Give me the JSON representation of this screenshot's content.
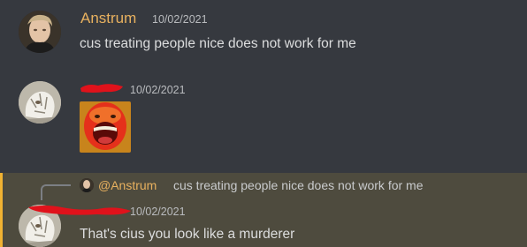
{
  "messages": [
    {
      "username": "Anstrum",
      "timestamp": "10/02/2021",
      "text": "cus treating people nice does not work for me",
      "username_color": "#e8b15f"
    },
    {
      "username": "",
      "timestamp": "10/02/2021",
      "attachment": "screaming-face-emoji"
    },
    {
      "username": "",
      "timestamp": "10/02/2021",
      "text": "That's cius you look like a murderer",
      "highlighted": true,
      "reply": {
        "username": "@Anstrum",
        "text": "cus treating people nice does not work for me"
      }
    }
  ],
  "colors": {
    "background": "#36393f",
    "mention_highlight": "#4e4b3e",
    "mention_bar": "#f0b232",
    "username": "#e8b15f",
    "redaction": "#e0121b"
  }
}
